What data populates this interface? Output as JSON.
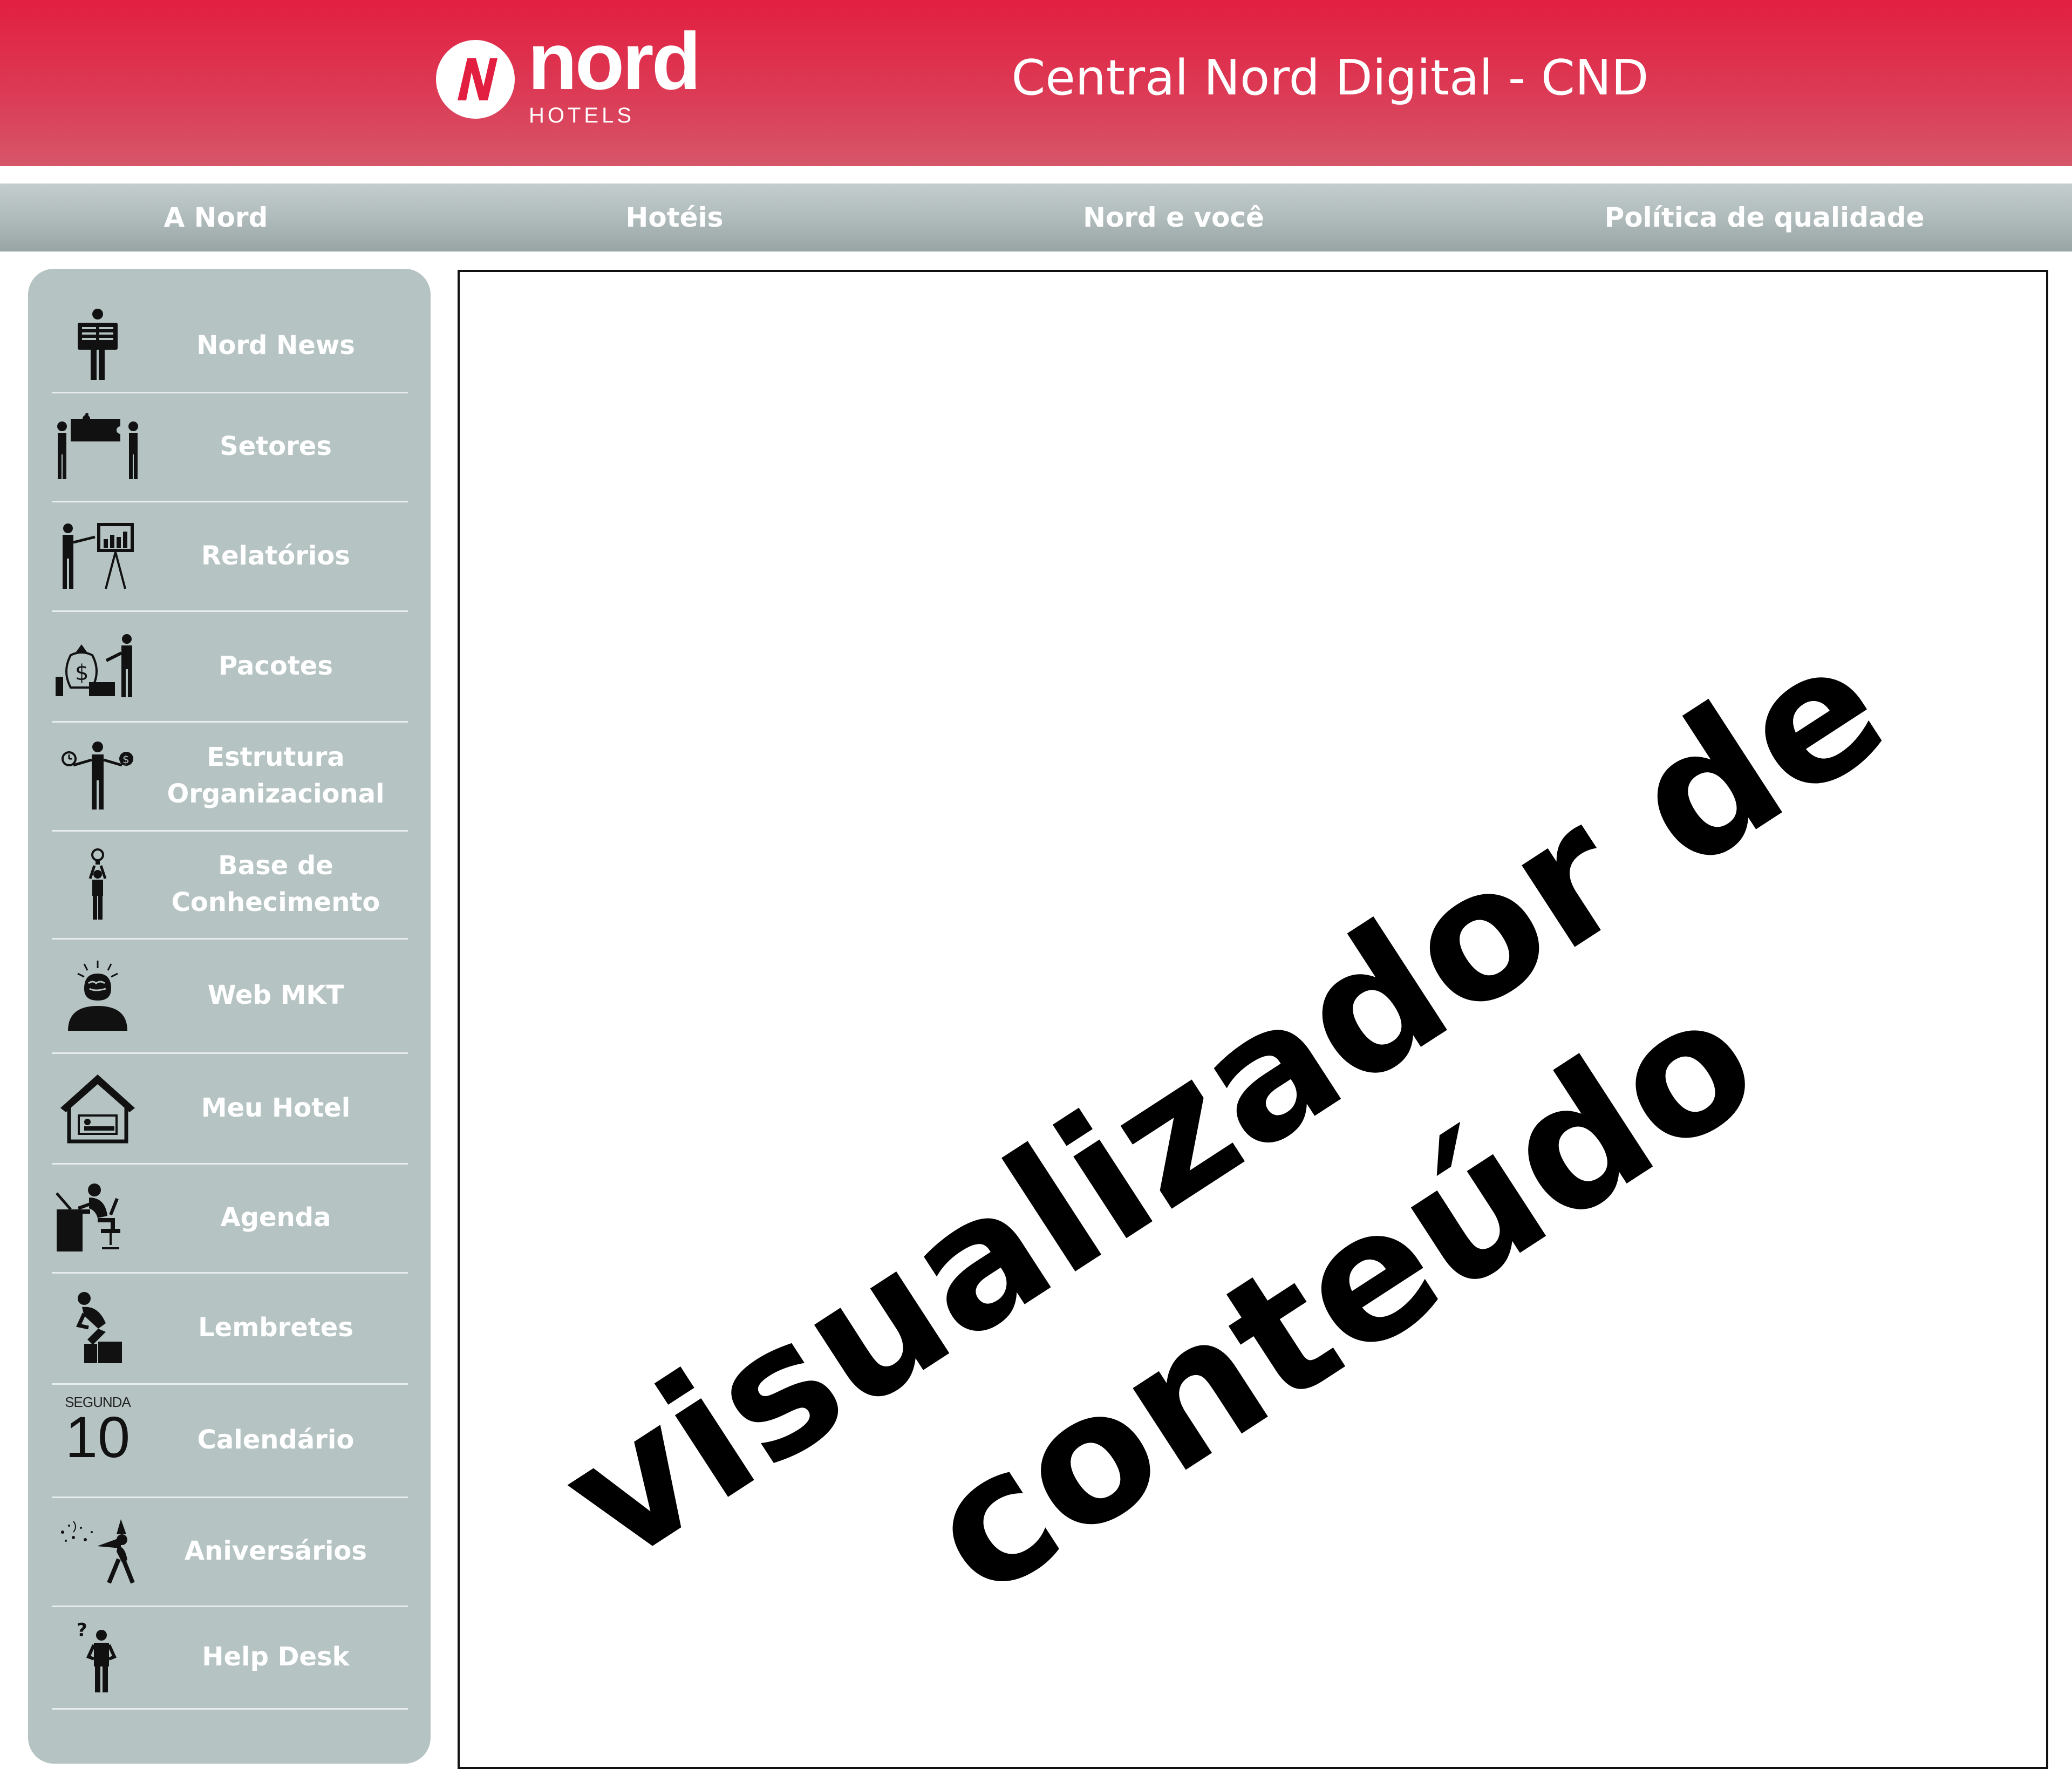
{
  "header": {
    "logo": {
      "word": "nord",
      "sub": "HOTELS",
      "mark": "N"
    },
    "title": "Central Nord Digital - CND",
    "background_color": "#e21f40"
  },
  "topnav": {
    "items": [
      {
        "label": "A Nord"
      },
      {
        "label": "Hotéis"
      },
      {
        "label": "Nord e você"
      },
      {
        "label": "Política de qualidade"
      }
    ]
  },
  "sidebar": {
    "background_color": "#b6c3c3",
    "items": [
      {
        "label": "Nord News",
        "icon": "newspaper-reader-icon"
      },
      {
        "label": "Setores",
        "icon": "puzzle-team-icon"
      },
      {
        "label": "Relatórios",
        "icon": "presentation-chart-icon"
      },
      {
        "label": "Pacotes",
        "icon": "money-bag-icon"
      },
      {
        "label": "Estrutura Organizacional",
        "icon": "balance-time-money-icon"
      },
      {
        "label": "Base de Conhecimento",
        "icon": "lightbulb-person-icon"
      },
      {
        "label": "Web MKT",
        "icon": "brain-idea-icon"
      },
      {
        "label": "Meu Hotel",
        "icon": "house-bed-icon"
      },
      {
        "label": "Agenda",
        "icon": "desk-worker-icon"
      },
      {
        "label": "Lembretes",
        "icon": "thinker-icon"
      },
      {
        "label": "Calendário",
        "icon": "calendar-date-icon",
        "weekday": "SEGUNDA",
        "day": "10"
      },
      {
        "label": "Aniversários",
        "icon": "party-horn-icon"
      },
      {
        "label": "Help Desk",
        "icon": "question-person-icon"
      }
    ]
  },
  "viewer": {
    "line1": "visualizador de",
    "line2": "conteúdo"
  }
}
